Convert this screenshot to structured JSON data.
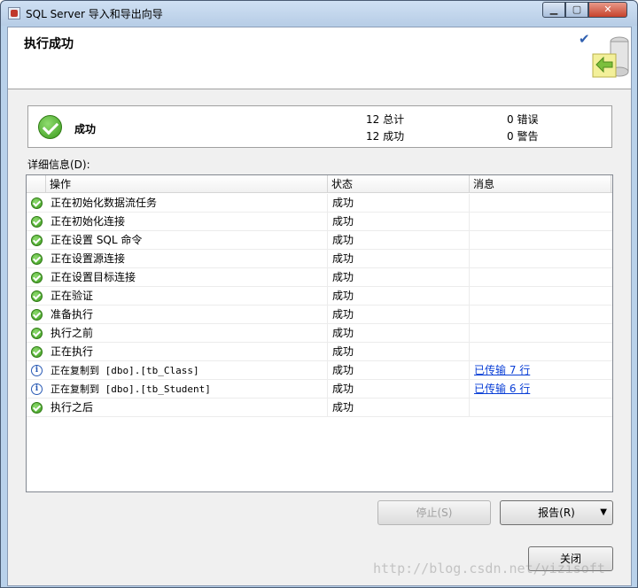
{
  "window": {
    "title": "SQL Server 导入和导出向导",
    "min_label": "▁",
    "max_label": "▢",
    "close_label": "✕"
  },
  "header": {
    "title": "执行成功"
  },
  "summary": {
    "status": "成功",
    "total_label": "12 总计",
    "success_label": "12 成功",
    "error_label": "0 错误",
    "warning_label": "0 警告"
  },
  "details": {
    "label": "详细信息(D):",
    "columns": [
      "操作",
      "状态",
      "消息"
    ],
    "rows": [
      {
        "icon": "success-icon",
        "action": "正在初始化数据流任务",
        "status": "成功",
        "message": ""
      },
      {
        "icon": "success-icon",
        "action": "正在初始化连接",
        "status": "成功",
        "message": ""
      },
      {
        "icon": "success-icon",
        "action": "正在设置 SQL 命令",
        "status": "成功",
        "message": ""
      },
      {
        "icon": "success-icon",
        "action": "正在设置源连接",
        "status": "成功",
        "message": ""
      },
      {
        "icon": "success-icon",
        "action": "正在设置目标连接",
        "status": "成功",
        "message": ""
      },
      {
        "icon": "success-icon",
        "action": "正在验证",
        "status": "成功",
        "message": ""
      },
      {
        "icon": "success-icon",
        "action": "准备执行",
        "status": "成功",
        "message": ""
      },
      {
        "icon": "success-icon",
        "action": "执行之前",
        "status": "成功",
        "message": ""
      },
      {
        "icon": "success-icon",
        "action": "正在执行",
        "status": "成功",
        "message": ""
      },
      {
        "icon": "info-icon",
        "action": "正在复制到 [dbo].[tb_Class]",
        "status": "成功",
        "message": "已传输 7 行"
      },
      {
        "icon": "info-icon",
        "action": "正在复制到 [dbo].[tb_Student]",
        "status": "成功",
        "message": "已传输 6 行"
      },
      {
        "icon": "success-icon",
        "action": "执行之后",
        "status": "成功",
        "message": ""
      }
    ]
  },
  "buttons": {
    "stop": "停止(S)",
    "report": "报告(R)",
    "close": "关闭"
  },
  "watermark": "http://blog.csdn.net/yizisoft"
}
